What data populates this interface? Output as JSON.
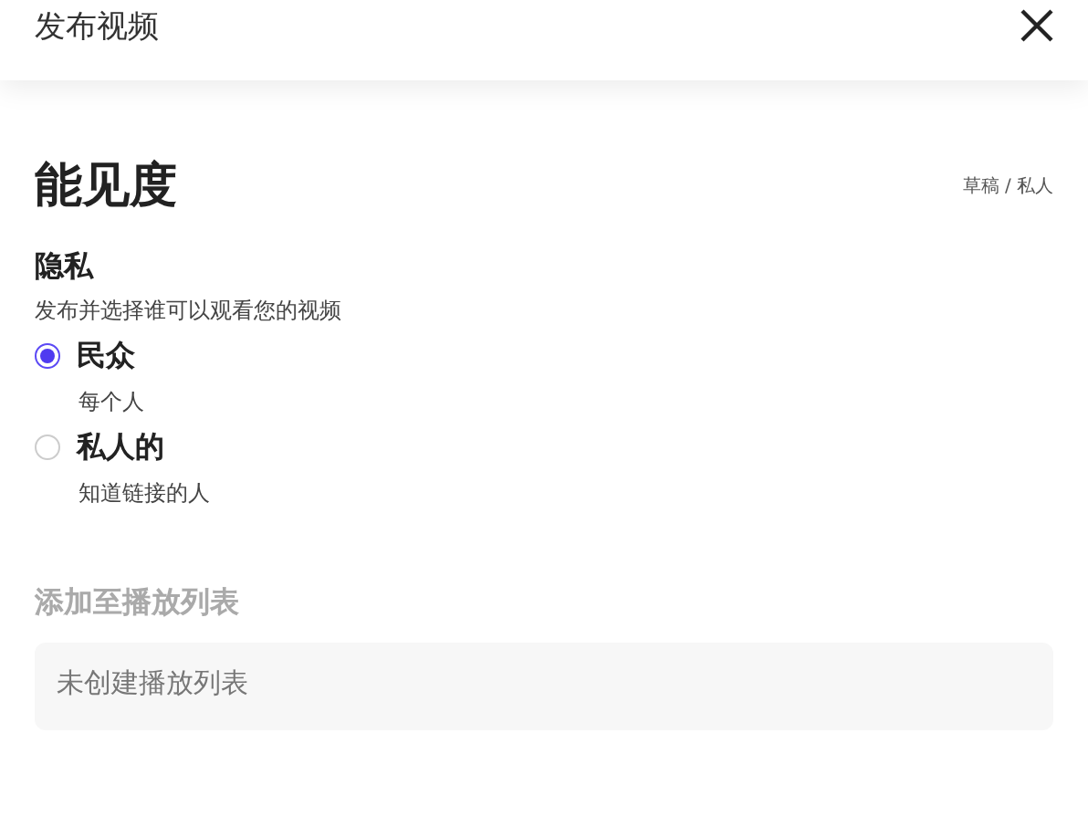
{
  "header": {
    "title": "发布视频"
  },
  "section": {
    "title": "能见度",
    "status": "草稿 / 私人"
  },
  "privacy": {
    "title": "隐私",
    "description": "发布并选择谁可以观看您的视频",
    "options": [
      {
        "label": "民众",
        "hint": "每个人",
        "selected": true
      },
      {
        "label": "私人的",
        "hint": "知道链接的人",
        "selected": false
      }
    ]
  },
  "playlist": {
    "title": "添加至播放列表",
    "placeholder": "未创建播放列表"
  }
}
